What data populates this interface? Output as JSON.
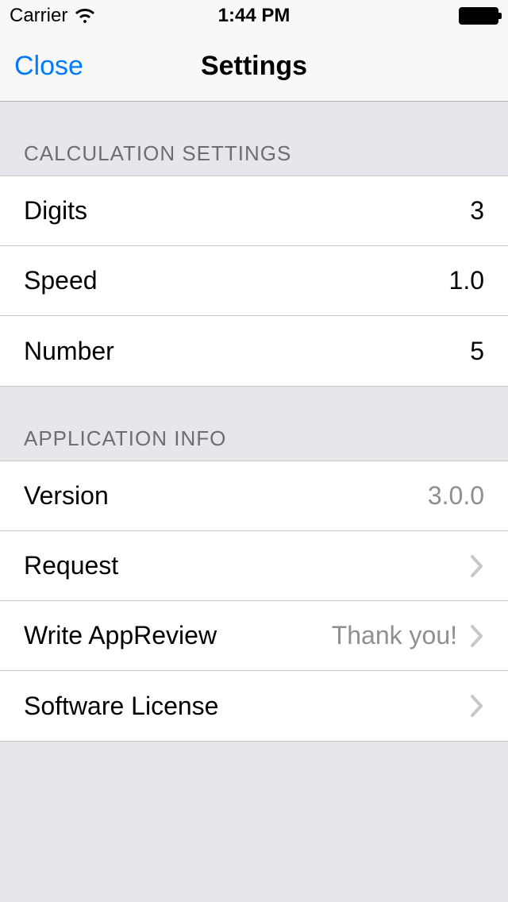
{
  "status_bar": {
    "carrier": "Carrier",
    "time": "1:44 PM"
  },
  "nav": {
    "close_label": "Close",
    "title": "Settings"
  },
  "sections": {
    "calculation": {
      "header": "CALCULATION SETTINGS",
      "digits_label": "Digits",
      "digits_value": "3",
      "speed_label": "Speed",
      "speed_value": "1.0",
      "number_label": "Number",
      "number_value": "5"
    },
    "app_info": {
      "header": "APPLICATION INFO",
      "version_label": "Version",
      "version_value": "3.0.0",
      "request_label": "Request",
      "review_label": "Write AppReview",
      "review_value": "Thank you!",
      "license_label": "Software License"
    }
  }
}
